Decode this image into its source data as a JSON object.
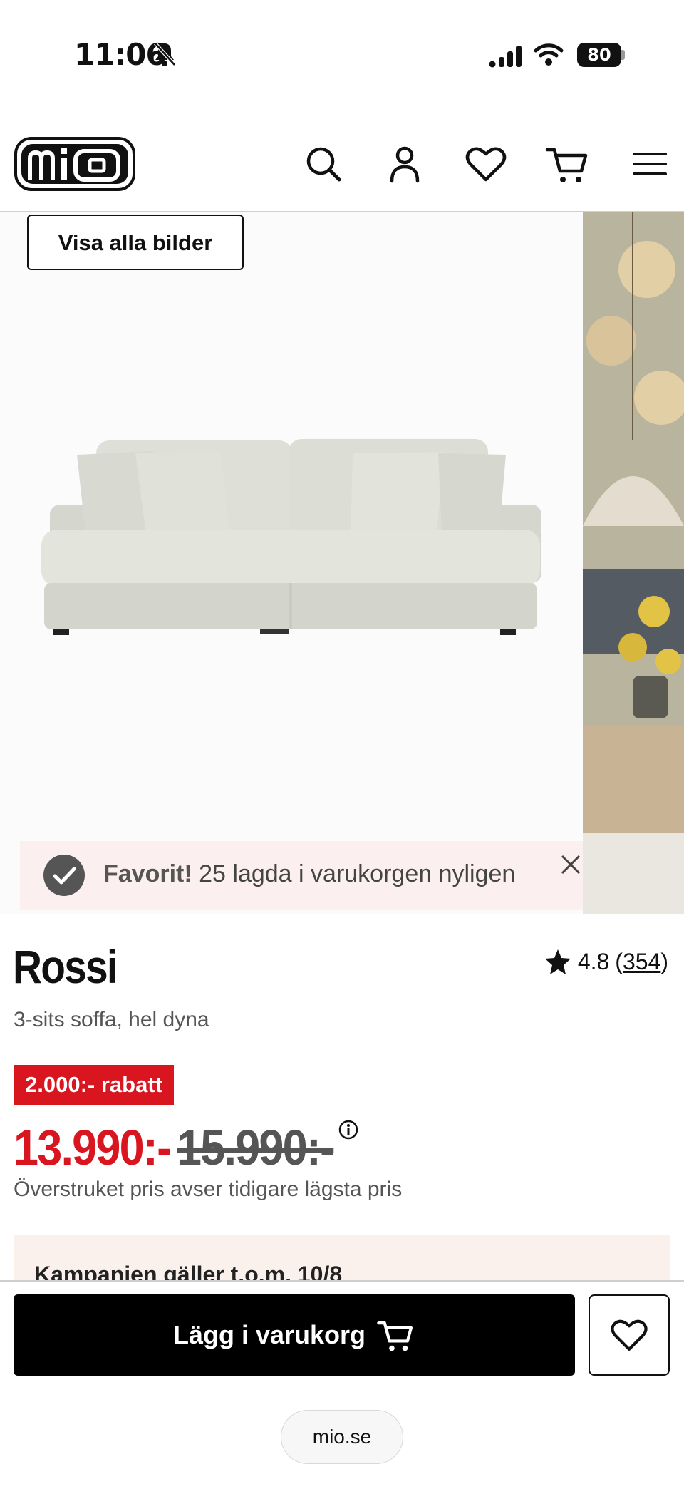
{
  "status_bar": {
    "time": "11:06",
    "battery": "80"
  },
  "header": {
    "logo_text": "mio",
    "icons": [
      "search-icon",
      "account-icon",
      "heart-icon",
      "cart-icon",
      "menu-icon"
    ]
  },
  "gallery": {
    "view_all_label": "Visa alla bilder"
  },
  "toast": {
    "bold": "Favorit!",
    "text": " 25 lagda i varukorgen nyligen"
  },
  "product": {
    "title": "Rossi",
    "subtitle": "3-sits soffa, hel dyna",
    "rating": "4.8",
    "reviews": "354",
    "discount_badge": "2.000:- rabatt",
    "price_now": "13.990:-",
    "price_was": "15.990:-",
    "price_note": "Överstruket pris avser tidigare lägsta pris",
    "campaign": "Kampanjen gäller t.o.m. 10/8"
  },
  "bottom_bar": {
    "add_to_cart_label": "Lägg i varukorg"
  },
  "browser": {
    "url": "mio.se"
  },
  "colors": {
    "sale_red": "#d9151f",
    "toast_bg": "#fcefef",
    "campaign_bg": "#fbf1ec"
  }
}
